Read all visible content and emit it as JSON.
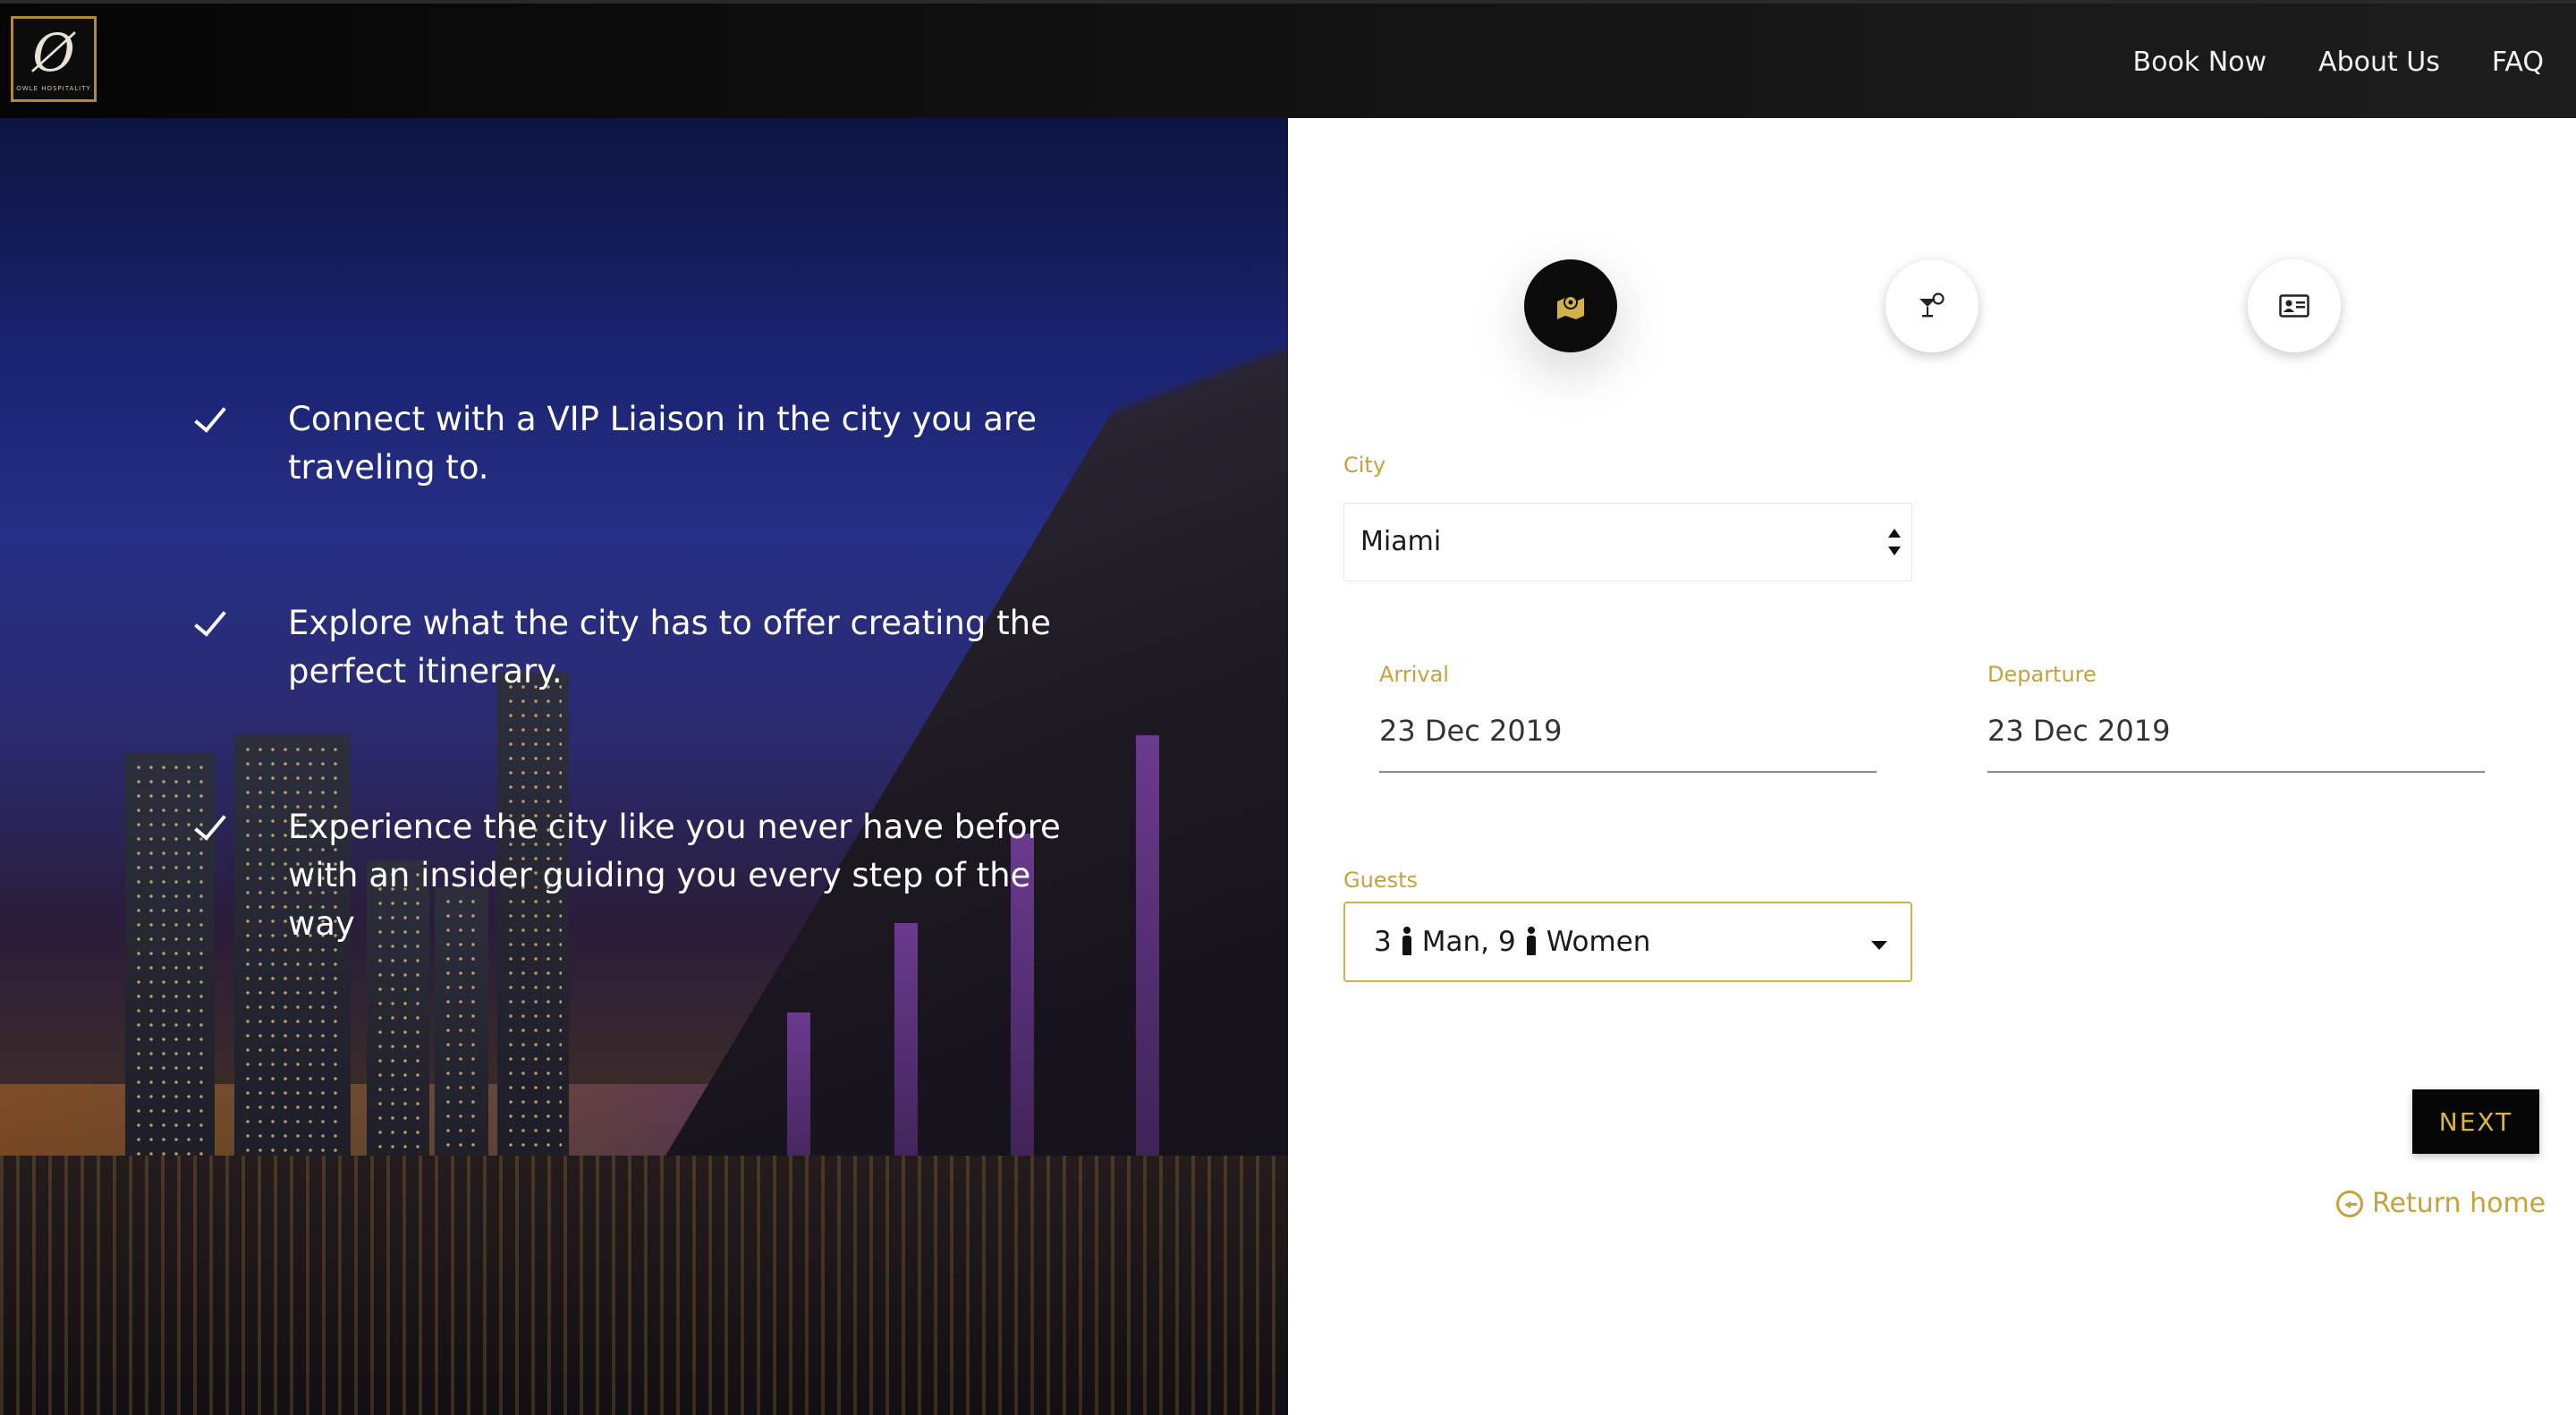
{
  "header": {
    "logo_text": "OWLE HOSPITALITY",
    "nav": [
      {
        "label": "Book Now"
      },
      {
        "label": "About Us"
      },
      {
        "label": "FAQ"
      }
    ]
  },
  "hero": {
    "benefits": [
      {
        "text": "Connect with a VIP Liaison in the city you are traveling to."
      },
      {
        "text": "Explore what the city has to offer creating the perfect itinerary."
      },
      {
        "text": "Experience the city like you never have before with an insider guiding you every step of the way"
      }
    ]
  },
  "steps": [
    {
      "icon": "map-location-icon",
      "active": true
    },
    {
      "icon": "cocktail-icon",
      "active": false
    },
    {
      "icon": "id-card-icon",
      "active": false
    }
  ],
  "form": {
    "city_label": "City",
    "city_value": "Miami",
    "arrival_label": "Arrival",
    "arrival_value": "23 Dec 2019",
    "departure_label": "Departure",
    "departure_value": "23 Dec 2019",
    "guests_label": "Guests",
    "guests_men_count": "3",
    "guests_men_label": "Man,",
    "guests_women_count": "9",
    "guests_women_label": "Women"
  },
  "actions": {
    "next_label": "NEXT",
    "return_label": "Return home"
  },
  "colors": {
    "accent_gold": "#c6a13c",
    "header_bg": "#0a0a0a",
    "button_bg": "#060606"
  }
}
